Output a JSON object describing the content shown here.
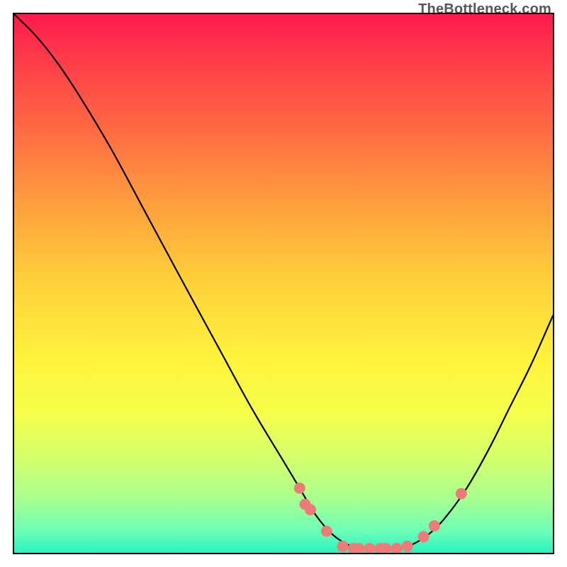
{
  "attribution": "TheBottleneck.com",
  "colors": {
    "gradient_top": "#ff1a4d",
    "gradient_bottom": "#28f2c0",
    "curve": "#000000",
    "dots": "#ed7b77",
    "border": "#000000"
  },
  "chart_data": {
    "type": "line",
    "title": "",
    "xlabel": "",
    "ylabel": "",
    "xlim": [
      0,
      100
    ],
    "ylim": [
      0,
      100
    ],
    "curve": [
      {
        "x": 0,
        "y": 100
      },
      {
        "x": 4,
        "y": 96
      },
      {
        "x": 8,
        "y": 91
      },
      {
        "x": 12,
        "y": 85
      },
      {
        "x": 18,
        "y": 75
      },
      {
        "x": 25,
        "y": 62
      },
      {
        "x": 32,
        "y": 49
      },
      {
        "x": 38,
        "y": 38
      },
      {
        "x": 44,
        "y": 27
      },
      {
        "x": 50,
        "y": 17
      },
      {
        "x": 53,
        "y": 12
      },
      {
        "x": 56,
        "y": 7
      },
      {
        "x": 59,
        "y": 3.5
      },
      {
        "x": 62,
        "y": 1.5
      },
      {
        "x": 65,
        "y": 0.7
      },
      {
        "x": 68,
        "y": 0.5
      },
      {
        "x": 71,
        "y": 0.7
      },
      {
        "x": 74,
        "y": 1.6
      },
      {
        "x": 77,
        "y": 3.5
      },
      {
        "x": 80,
        "y": 6.5
      },
      {
        "x": 84,
        "y": 12
      },
      {
        "x": 88,
        "y": 19
      },
      {
        "x": 92,
        "y": 27
      },
      {
        "x": 96,
        "y": 35
      },
      {
        "x": 100,
        "y": 44
      }
    ],
    "points": [
      {
        "x": 53,
        "y": 12
      },
      {
        "x": 54,
        "y": 9
      },
      {
        "x": 55,
        "y": 8
      },
      {
        "x": 58,
        "y": 4
      },
      {
        "x": 61,
        "y": 1.2
      },
      {
        "x": 63,
        "y": 0.8
      },
      {
        "x": 64,
        "y": 0.8
      },
      {
        "x": 66,
        "y": 0.8
      },
      {
        "x": 68,
        "y": 0.8
      },
      {
        "x": 69,
        "y": 0.8
      },
      {
        "x": 71,
        "y": 0.8
      },
      {
        "x": 73,
        "y": 1.2
      },
      {
        "x": 76,
        "y": 3
      },
      {
        "x": 78,
        "y": 5
      },
      {
        "x": 83,
        "y": 11
      }
    ]
  }
}
